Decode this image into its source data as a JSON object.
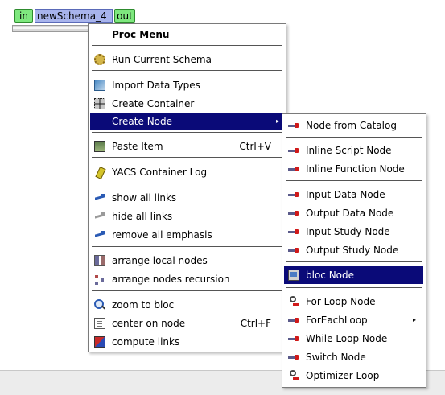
{
  "schema_node": {
    "in_port": "in",
    "title": "newSchema_4",
    "out_port": "out"
  },
  "proc_menu": {
    "title": "Proc Menu",
    "items": [
      {
        "label": "Run Current Schema",
        "icon": "gear-icon"
      },
      {
        "label": "Import Data Types",
        "icon": "import-types-icon"
      },
      {
        "label": "Create Container",
        "icon": "container-icon"
      },
      {
        "label": "Create Node",
        "icon": "",
        "submenu_arrow": "▸"
      },
      {
        "label": "Paste Item",
        "icon": "paste-icon",
        "shortcut": "Ctrl+V"
      },
      {
        "label": "YACS Container Log",
        "icon": "log-icon"
      },
      {
        "label": "show all links",
        "icon": "show-links-icon"
      },
      {
        "label": "hide all links",
        "icon": "hide-links-icon"
      },
      {
        "label": "remove all emphasis",
        "icon": "remove-emphasis-icon"
      },
      {
        "label": "arrange local nodes",
        "icon": "arrange-local-icon"
      },
      {
        "label": "arrange nodes recursion",
        "icon": "arrange-recursion-icon"
      },
      {
        "label": "zoom to bloc",
        "icon": "zoom-icon"
      },
      {
        "label": "center on node",
        "icon": "center-icon",
        "shortcut": "Ctrl+F"
      },
      {
        "label": "compute links",
        "icon": "compute-links-icon"
      }
    ]
  },
  "create_node_menu": {
    "items": [
      {
        "label": "Node from Catalog",
        "icon": "node-arrow-icon"
      },
      {
        "label": "Inline Script Node",
        "icon": "node-arrow-icon"
      },
      {
        "label": "Inline Function Node",
        "icon": "node-arrow-icon"
      },
      {
        "label": "Input Data Node",
        "icon": "node-arrow-icon"
      },
      {
        "label": "Output Data Node",
        "icon": "node-arrow-icon"
      },
      {
        "label": "Input Study Node",
        "icon": "node-arrow-icon"
      },
      {
        "label": "Output Study Node",
        "icon": "node-arrow-icon"
      },
      {
        "label": "bloc Node",
        "icon": "bloc-icon"
      },
      {
        "label": "For Loop Node",
        "icon": "loop-icon"
      },
      {
        "label": "ForEachLoop",
        "icon": "node-arrow-icon",
        "submenu_arrow": "▸"
      },
      {
        "label": "While Loop Node",
        "icon": "node-arrow-icon"
      },
      {
        "label": "Switch Node",
        "icon": "node-arrow-icon"
      },
      {
        "label": "Optimizer Loop",
        "icon": "loop-icon"
      }
    ]
  },
  "colors": {
    "selection": "#0a0a78",
    "port_green": "#7ee87e",
    "node_title_blue": "#a8b4ec"
  }
}
